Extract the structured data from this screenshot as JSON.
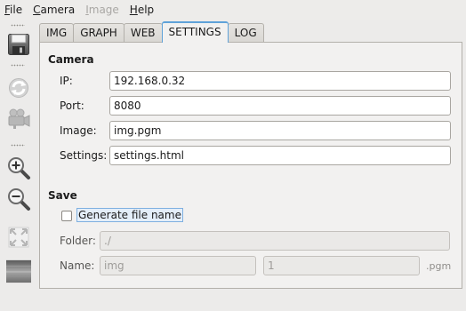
{
  "menubar": {
    "file": {
      "mnemonic": "F",
      "rest": "ile"
    },
    "camera": {
      "mnemonic": "C",
      "rest": "amera"
    },
    "image": {
      "mnemonic": "I",
      "rest": "mage"
    },
    "help": {
      "mnemonic": "H",
      "rest": "elp"
    }
  },
  "toolbar": {
    "buttons": [
      {
        "icon": "save-icon",
        "enabled": true
      },
      {
        "icon": "refresh-icon",
        "enabled": false
      },
      {
        "icon": "video-camera-icon",
        "enabled": false
      },
      {
        "icon": "zoom-in-icon",
        "enabled": true
      },
      {
        "icon": "zoom-out-icon",
        "enabled": true
      },
      {
        "icon": "fit-to-window-icon",
        "enabled": false
      },
      {
        "icon": "grayscale-bar-icon",
        "enabled": true
      }
    ]
  },
  "tabs": [
    {
      "label": "IMG",
      "active": false
    },
    {
      "label": "GRAPH",
      "active": false
    },
    {
      "label": "WEB",
      "active": false
    },
    {
      "label": "SETTINGS",
      "active": true
    },
    {
      "label": "LOG",
      "active": false
    }
  ],
  "camera_section": {
    "title": "Camera",
    "ip_label": "IP:",
    "ip_value": "192.168.0.32",
    "port_label": "Port:",
    "port_value": "8080",
    "image_label": "Image:",
    "image_value": "img.pgm",
    "settings_label": "Settings:",
    "settings_value": "settings.html"
  },
  "save_section": {
    "title": "Save",
    "generate_checked": false,
    "generate_label": "Generate file name",
    "folder_label": "Folder:",
    "folder_value": "./",
    "name_label": "Name:",
    "name_value": "img",
    "index_value": "1",
    "extension": ".pgm"
  },
  "colors": {
    "accent": "#5fa2d9",
    "panel_bg": "#f2f1f0",
    "window_bg": "#ecebea"
  }
}
